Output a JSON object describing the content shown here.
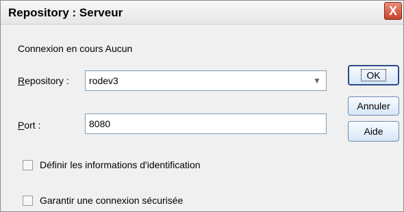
{
  "window": {
    "title": "Repository : Serveur",
    "close_glyph": "X"
  },
  "status": {
    "text": "Connexion en cours Aucun"
  },
  "repository": {
    "label_underlined": "R",
    "label_rest": "epository :",
    "value": "rodev3",
    "arrow_glyph": "▼"
  },
  "port": {
    "label_underlined": "P",
    "label_rest": "ort :",
    "value": "8080"
  },
  "buttons": {
    "ok": "OK",
    "cancel": "Annuler",
    "help": "Aide"
  },
  "options": {
    "credentials": {
      "label": "Définir les informations d'identification",
      "checked": false
    },
    "secure": {
      "label": "Garantir une connexion sécurisée",
      "checked": false
    }
  }
}
